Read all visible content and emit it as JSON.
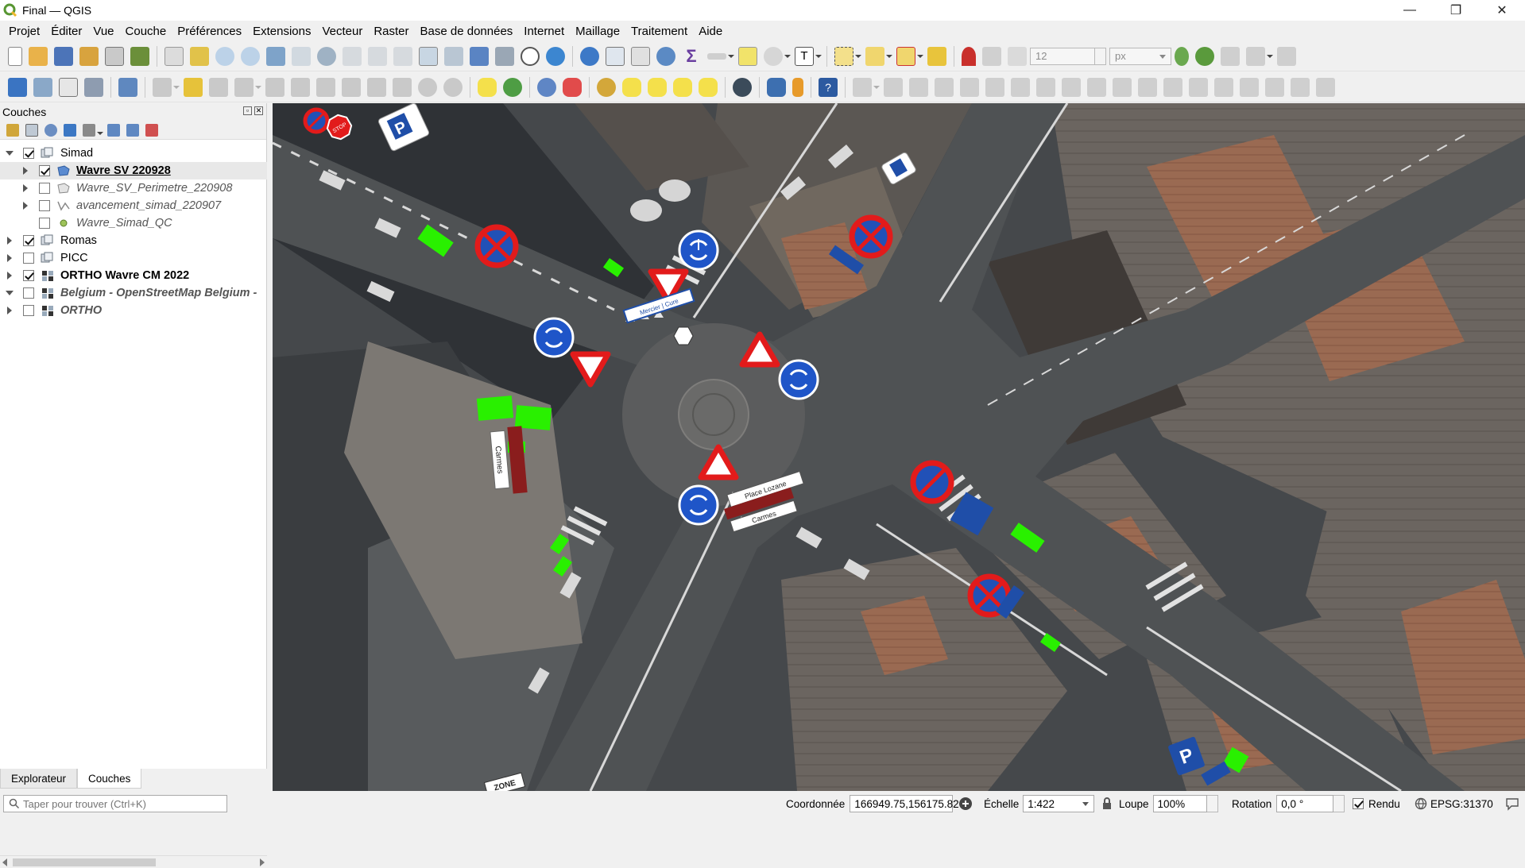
{
  "window": {
    "title": "Final — QGIS",
    "minimize_glyph": "—",
    "maximize_glyph": "❐",
    "close_glyph": "✕"
  },
  "menu": [
    {
      "label": "Projet",
      "u": "P"
    },
    {
      "label": "Éditer",
      "u": "É"
    },
    {
      "label": "Vue",
      "u": "V"
    },
    {
      "label": "Couche",
      "u": "C"
    },
    {
      "label": "Préférences",
      "u": "P"
    },
    {
      "label": "Extensions",
      "u": "E"
    },
    {
      "label": "Vecteur",
      "u": "V"
    },
    {
      "label": "Raster",
      "u": "R"
    },
    {
      "label": "Base de données",
      "u": "B"
    },
    {
      "label": "Internet",
      "u": "I"
    },
    {
      "label": "Maillage",
      "u": "M"
    },
    {
      "label": "Traitement",
      "u": "T"
    },
    {
      "label": "Aide",
      "u": "A"
    }
  ],
  "toolbar": {
    "snap_tolerance_value": "12",
    "snap_unit": "px"
  },
  "layers_panel": {
    "title": "Couches",
    "float_glyph": "▫",
    "close_glyph": "✕",
    "layers": [
      {
        "name": "Simad",
        "level": 0,
        "expand": "open",
        "checked": true,
        "icon": "group-icon",
        "style": "normal"
      },
      {
        "name": "Wavre SV 220928",
        "level": 1,
        "expand": "closed",
        "checked": true,
        "icon": "polygon-layer-icon",
        "style": "ul",
        "selected": true
      },
      {
        "name": "Wavre_SV_Perimetre_220908",
        "level": 1,
        "expand": "closed",
        "checked": false,
        "icon": "polygon-outline-icon",
        "style": "italic"
      },
      {
        "name": "avancement_simad_220907",
        "level": 1,
        "expand": "closed",
        "checked": false,
        "icon": "line-layer-icon",
        "style": "italic"
      },
      {
        "name": "Wavre_Simad_QC",
        "level": 1,
        "expand": "none",
        "checked": false,
        "icon": "point-layer-icon",
        "style": "italic"
      },
      {
        "name": "Romas",
        "level": 0,
        "expand": "closed",
        "checked": true,
        "icon": "group-icon",
        "style": "normal"
      },
      {
        "name": "PICC",
        "level": 0,
        "expand": "closed",
        "checked": false,
        "icon": "group-icon",
        "style": "normal"
      },
      {
        "name": "ORTHO Wavre CM 2022",
        "level": 0,
        "expand": "closed",
        "checked": true,
        "icon": "raster-layer-icon",
        "style": "bold"
      },
      {
        "name": "Belgium - OpenStreetMap Belgium -",
        "level": 0,
        "expand": "open",
        "checked": false,
        "icon": "raster-layer-icon",
        "style": "italicbold"
      },
      {
        "name": "ORTHO",
        "level": 0,
        "expand": "closed",
        "checked": false,
        "icon": "raster-layer-icon",
        "style": "italicbold"
      }
    ]
  },
  "bottom_tabs": [
    {
      "label": "Explorateur",
      "active": false
    },
    {
      "label": "Couches",
      "active": true
    }
  ],
  "map": {
    "sign_texts": {
      "street_sign_1": "Mercier | Cure",
      "street_sign_2": "Carmes",
      "street_sign_3": "Place Lozane",
      "street_sign_4": "Carmes",
      "zone_label": "ZONE",
      "stop_label": "STOP",
      "parking_label": "P"
    }
  },
  "statusbar": {
    "locator_placeholder": "Taper pour trouver (Ctrl+K)",
    "coordinate_label": "Coordonnée",
    "coordinate_value": "166949.75,156175.82",
    "scale_label": "Échelle",
    "scale_value": "1:422",
    "magnifier_label": "Loupe",
    "magnifier_value": "100%",
    "rotation_label": "Rotation",
    "rotation_value": "0,0 °",
    "render_label": "Rendu",
    "render_checked": true,
    "crs_label": "EPSG:31370"
  }
}
